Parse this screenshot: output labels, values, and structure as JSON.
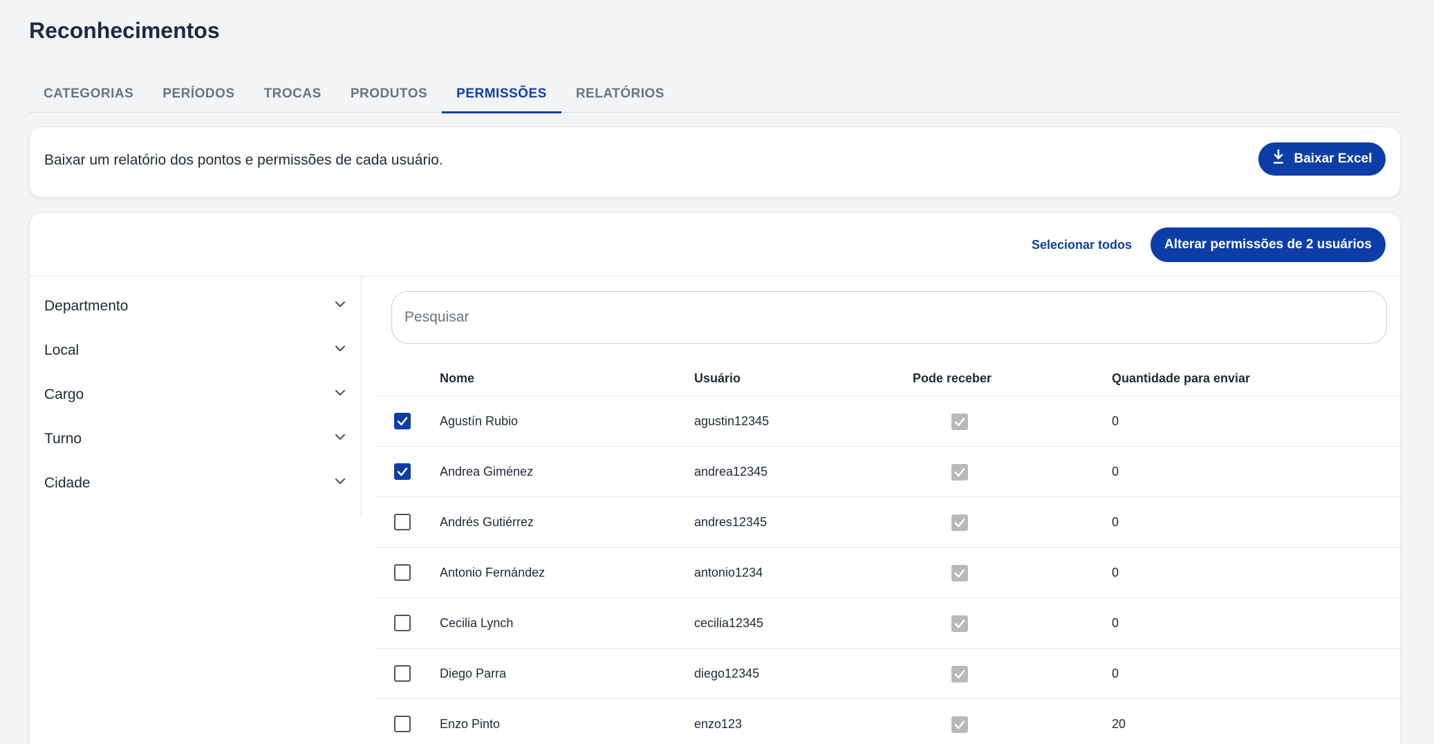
{
  "header": {
    "title": "Reconhecimentos"
  },
  "tabs": [
    {
      "label": "CATEGORIAS"
    },
    {
      "label": "PERÍODOS"
    },
    {
      "label": "TROCAS"
    },
    {
      "label": "PRODUTOS"
    },
    {
      "label": "PERMISSÕES"
    },
    {
      "label": "RELATÓRIOS"
    }
  ],
  "active_tab": "PERMISSÕES",
  "report": {
    "text": "Baixar um relatório dos pontos e permissões de cada usuário.",
    "button_label": "Baixar Excel",
    "button_icon": "download-icon"
  },
  "actions": {
    "select_all": "Selecionar todos",
    "change_permissions": "Alterar permissões de 2 usuários"
  },
  "filters": [
    {
      "label": "Departmento"
    },
    {
      "label": "Local"
    },
    {
      "label": "Cargo"
    },
    {
      "label": "Turno"
    },
    {
      "label": "Cidade"
    }
  ],
  "search": {
    "placeholder": "Pesquisar",
    "value": ""
  },
  "table": {
    "columns": {
      "name": "Nome",
      "user": "Usuário",
      "receive": "Pode receber",
      "quantity": "Quantidade para enviar"
    },
    "rows": [
      {
        "name": "Agustín Rubio",
        "user": "agustin12345",
        "selected": true,
        "can_receive": true,
        "quantity": "0"
      },
      {
        "name": "Andrea Giménez",
        "user": "andrea12345",
        "selected": true,
        "can_receive": true,
        "quantity": "0"
      },
      {
        "name": "Andrés Gutiérrez",
        "user": "andres12345",
        "selected": false,
        "can_receive": true,
        "quantity": "0"
      },
      {
        "name": "Antonio Fernández",
        "user": "antonio1234",
        "selected": false,
        "can_receive": true,
        "quantity": "0"
      },
      {
        "name": "Cecilia Lynch",
        "user": "cecilia12345",
        "selected": false,
        "can_receive": true,
        "quantity": "0"
      },
      {
        "name": "Diego Parra",
        "user": "diego12345",
        "selected": false,
        "can_receive": true,
        "quantity": "0"
      },
      {
        "name": "Enzo Pinto",
        "user": "enzo123",
        "selected": false,
        "can_receive": true,
        "quantity": "20"
      }
    ]
  },
  "colors": {
    "primary": "#0d3ea8",
    "background": "#f3f4f6",
    "disabled_check": "#b7b9bd"
  }
}
